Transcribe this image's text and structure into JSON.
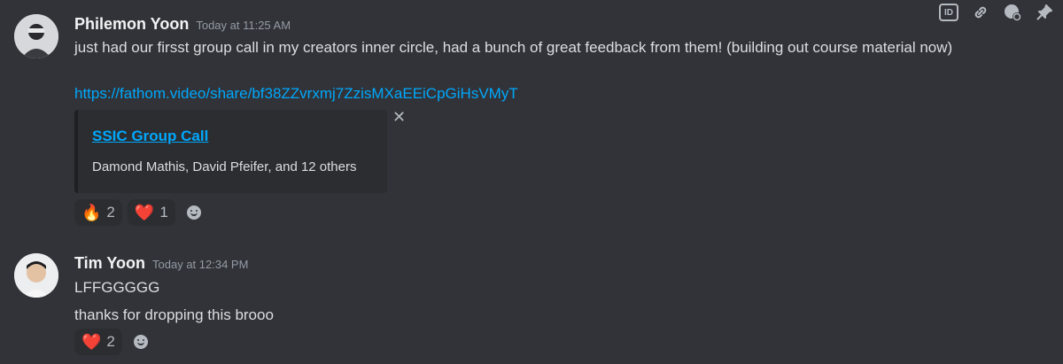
{
  "toolbar": {
    "id_label": "ID",
    "icons": [
      "id-icon",
      "link-icon",
      "thread-icon",
      "pin-icon"
    ]
  },
  "messages": [
    {
      "author": "Philemon Yoon",
      "timestamp": "Today at 11:25 AM",
      "text": "just had our firsst group call in my creators inner circle, had a bunch of great feedback from them! (building out course material now)",
      "link": "https://fathom.video/share/bf38ZZvrxmj7ZzisMXaEEiCpGiHsVMyT",
      "embed": {
        "title": "SSIC Group Call",
        "description": "Damond Mathis, David Pfeifer, and 12 others"
      },
      "reactions": [
        {
          "emoji": "🔥",
          "count": "2"
        },
        {
          "emoji": "❤️",
          "count": "1"
        }
      ]
    },
    {
      "author": "Tim Yoon",
      "timestamp": "Today at 12:34 PM",
      "lines": [
        "LFFGGGGG",
        "thanks for dropping this brooo"
      ],
      "reactions": [
        {
          "emoji": "❤️",
          "count": "2"
        }
      ]
    }
  ]
}
